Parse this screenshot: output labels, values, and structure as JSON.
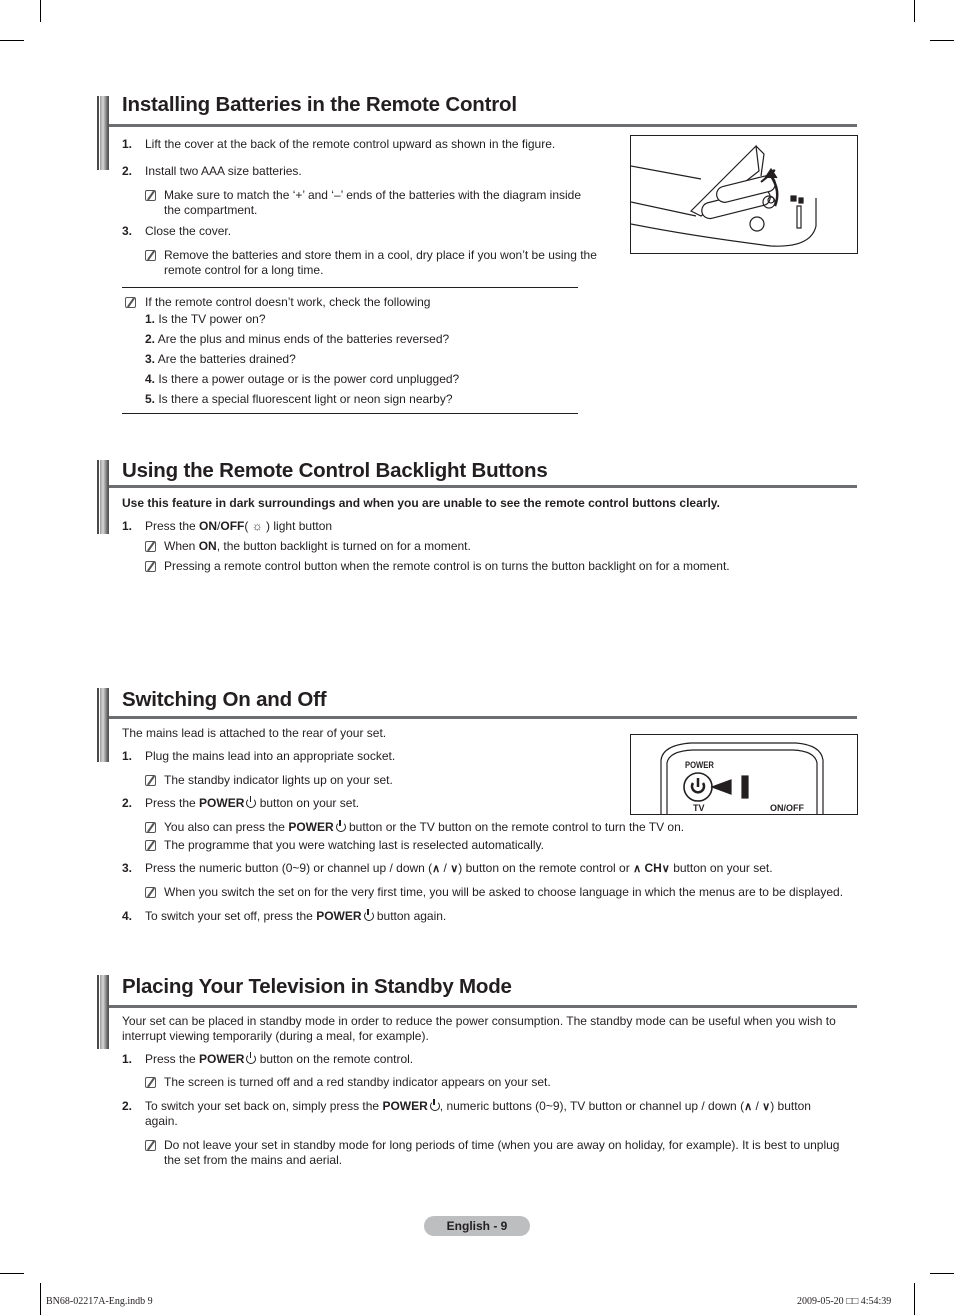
{
  "sections": {
    "batteries": {
      "title": "Installing Batteries in the Remote Control",
      "steps": [
        {
          "num": "1.",
          "text": "Lift the cover at the back of the remote control upward as shown in the figure."
        },
        {
          "num": "2.",
          "text": "Install two AAA size batteries."
        },
        {
          "num": "3.",
          "text": "Close the cover."
        }
      ],
      "notes": {
        "match_l1": "Make sure to match the ‘+’ and ‘–’ ends of the batteries with the diagram inside",
        "match_l2": "the compartment.",
        "remove_l1": "Remove the batteries and store them in a cool, dry place if you won’t be using the",
        "remove_l2": "remote control for a long time."
      },
      "troubleshoot": {
        "intro": "If the remote control doesn’t work, check the following",
        "items": [
          {
            "num": "1.",
            "text": " Is the TV power on?"
          },
          {
            "num": "2.",
            "text": " Are the plus and minus ends of the batteries reversed?"
          },
          {
            "num": "3.",
            "text": " Are the batteries drained?"
          },
          {
            "num": "4.",
            "text": " Is there a power outage or is the power cord unplugged?"
          },
          {
            "num": "5.",
            "text": " Is there a special fluorescent light or neon sign nearby?"
          }
        ]
      }
    },
    "backlight": {
      "title": "Using the Remote Control Backlight Buttons",
      "intro": "Use this feature in dark surroundings and when you are unable to see the remote control buttons clearly.",
      "step1": {
        "num": "1.",
        "pre": "Press the ",
        "bold": "ON",
        "slash": "/",
        "bold2": "OFF",
        "paren_open": "( ",
        "icon": "☼",
        "post": " ) light button"
      },
      "note1": {
        "pre": "When ",
        "bold": "ON",
        "post": ", the button backlight is turned on for a moment."
      },
      "note2": "Pressing a remote control button when the remote control is on turns the button backlight on for a moment."
    },
    "switching": {
      "title": "Switching On and Off",
      "intro": "The mains lead is attached to the rear of your set.",
      "step1": {
        "num": "1.",
        "text": "Plug the mains lead into an appropriate socket."
      },
      "note1": "The standby indicator lights up on your set.",
      "step2": {
        "num": "2.",
        "pre": "Press the  ",
        "bold": "POWER",
        "post": " button on your set."
      },
      "note2": {
        "pre": "You also can press the ",
        "bold": "POWER",
        "post": "  button or the TV button on the remote control to turn the TV on."
      },
      "note3": "The programme that you were watching last is reselected automatically.",
      "step3": {
        "num": "3.",
        "pre": "Press the numeric button (0~9) or channel up / down (",
        "up": "∧",
        "sep": " / ",
        "down": "∨",
        "mid": ") button on the remote control or ",
        "up2": "∧",
        "ch": " CH",
        "down2": "∨",
        "post": " button on your set."
      },
      "note4": "When you switch the set on for the very first time, you will be asked to choose language in which the menus are to be displayed.",
      "step4": {
        "num": "4.",
        "pre": "To switch your set off, press the ",
        "bold": "POWER",
        "post": " button again."
      },
      "figure": {
        "power_label": "POWER",
        "tv_label": "TV",
        "onoff_label": "ON/OFF"
      }
    },
    "standby": {
      "title": "Placing Your Television in Standby Mode",
      "intro_l1": "Your set can be placed in standby mode in order to reduce the power consumption. The standby mode can be useful when you wish to",
      "intro_l2": "interrupt viewing temporarily (during a meal, for example).",
      "step1": {
        "num": "1.",
        "pre": "Press the  ",
        "bold": "POWER",
        "post": " button on the remote control."
      },
      "note1": "The screen is turned off and a red standby indicator appears on your set.",
      "step2": {
        "num": "2.",
        "pre": "To switch your set back on, simply press the  ",
        "bold": "POWER",
        "mid": ", numeric buttons (0~9), TV button or channel up / down (",
        "up": "∧",
        "sep": " / ",
        "down": "∨",
        "post": ") button",
        "l2": "again."
      },
      "note2_l1": "Do not leave your set in standby mode for long periods of time (when you are away on holiday, for example). It is best to unplug",
      "note2_l2": "the set from the mains and aerial."
    }
  },
  "footer": {
    "page_label": "English - 9",
    "file": "BN68-02217A-Eng.indb   9",
    "timestamp": "2009-05-20   □□ 4:54:39"
  }
}
